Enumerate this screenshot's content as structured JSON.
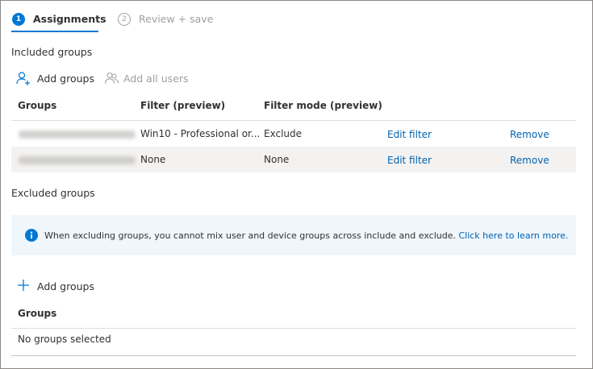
{
  "wizard": {
    "steps": [
      {
        "number": "1",
        "label": "Assignments"
      },
      {
        "number": "2",
        "label": "Review + save"
      }
    ]
  },
  "included": {
    "title": "Included groups",
    "add_groups_label": "Add groups",
    "add_all_users_label": "Add all users",
    "columns": [
      "Groups",
      "Filter (preview)",
      "Filter mode (preview)"
    ],
    "rows": [
      {
        "filter": "Win10 - Professional or...",
        "filter_mode": "Exclude",
        "edit_label": "Edit filter",
        "remove_label": "Remove"
      },
      {
        "filter": "None",
        "filter_mode": "None",
        "edit_label": "Edit filter",
        "remove_label": "Remove"
      }
    ]
  },
  "excluded": {
    "title": "Excluded groups",
    "info_message": "When excluding groups, you cannot mix user and device groups across include and exclude.",
    "info_link": "Click here to learn more.",
    "add_groups_label": "Add groups",
    "column": "Groups",
    "empty_text": "No groups selected"
  },
  "colors": {
    "accent": "#0078d4",
    "link": "#0063b1",
    "info_bg": "#eff6fc"
  }
}
